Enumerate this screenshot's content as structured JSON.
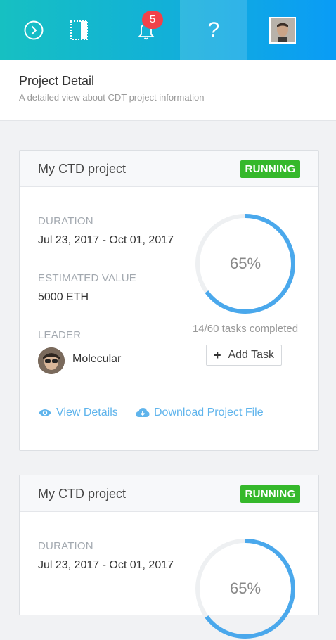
{
  "topbar": {
    "items": [
      {
        "icon": "chevron-right-circle-icon"
      },
      {
        "icon": "panel-toggle-icon"
      },
      {
        "icon": "bell-icon",
        "badge": "5"
      },
      {
        "icon": "help-icon",
        "glyph": "?"
      },
      {
        "icon": "user-avatar"
      }
    ]
  },
  "header": {
    "title": "Project Detail",
    "subtitle": "A detailed view about CDT project information"
  },
  "projects": [
    {
      "name": "My CTD project",
      "status": "RUNNING",
      "duration_label": "DURATION",
      "duration": "Jul 23, 2017 - Oct 01, 2017",
      "value_label": "ESTIMATED VALUE",
      "value": "5000 ETH",
      "leader_label": "LEADER",
      "leader": "Molecular",
      "progress_percent": 65,
      "progress_text": "65%",
      "tasks": "14/60 tasks completed",
      "add_task": "Add Task",
      "view_details": "View Details",
      "download": "Download Project File"
    },
    {
      "name": "My CTD project",
      "status": "RUNNING",
      "duration_label": "DURATION",
      "duration": "Jul 23, 2017 - Oct 01, 2017",
      "progress_percent": 65,
      "progress_text": "65%"
    }
  ],
  "colors": {
    "accent": "#4aa8ec",
    "status_running": "#35b82b",
    "badge": "#f1424a",
    "link": "#5fb4ec"
  }
}
